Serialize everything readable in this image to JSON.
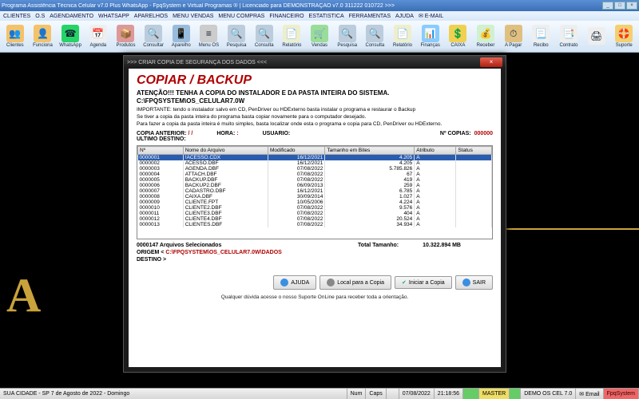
{
  "window": {
    "title": "Programa Assistência Técnica Celular v7.0 Plus WhatsApp - FpqSystem e Virtual Programas ® | Licenciado para  DEMONSTRAÇÃO v7.0 311222 010722 >>>"
  },
  "menu": [
    "CLIENTES",
    "O.S",
    "AGENDAMENTO",
    "WHATSAPP",
    "APARELHOS",
    "MENU VENDAS",
    "MENU COMPRAS",
    "FINANCEIRO",
    "ESTATISTICA",
    "FERRAMENTAS",
    "AJUDA",
    "✉ E-MAIL"
  ],
  "toolbar": [
    {
      "label": "Clientes",
      "ic": "👥",
      "bg": "#f3c26b"
    },
    {
      "label": "Funciona",
      "ic": "👤",
      "bg": "#f3c26b"
    },
    {
      "label": "WhatsApp",
      "ic": "☎",
      "bg": "#25d366"
    },
    {
      "label": "Agenda",
      "ic": "📅",
      "bg": "#eee"
    },
    {
      "label": "Produtos",
      "ic": "📦",
      "bg": "#d99"
    },
    {
      "label": "Consultar",
      "ic": "🔍",
      "bg": "#bcd"
    },
    {
      "label": "Aparelho",
      "ic": "📱",
      "bg": "#9bd"
    },
    {
      "label": "Menu OS",
      "ic": "≡",
      "bg": "#ccc"
    },
    {
      "label": "Pesquisa",
      "ic": "🔍",
      "bg": "#bcd"
    },
    {
      "label": "Consulta",
      "ic": "🔍",
      "bg": "#bcd"
    },
    {
      "label": "Relatório",
      "ic": "📄",
      "bg": "#eec"
    },
    {
      "label": "Vendas",
      "ic": "🛒",
      "bg": "#9d9"
    },
    {
      "label": "Pesquisa",
      "ic": "🔍",
      "bg": "#bcd"
    },
    {
      "label": "Consulta",
      "ic": "🔍",
      "bg": "#bcd"
    },
    {
      "label": "Relatório",
      "ic": "📄",
      "bg": "#eec"
    },
    {
      "label": "Finanças",
      "ic": "📊",
      "bg": "#8cf"
    },
    {
      "label": "CAIXA",
      "ic": "💲",
      "bg": "#f0d050"
    },
    {
      "label": "Receber",
      "ic": "💰",
      "bg": "#d0f0d0"
    },
    {
      "label": "A Pagar",
      "ic": "⏱",
      "bg": "#e0c080"
    },
    {
      "label": "Recibo",
      "ic": "📃",
      "bg": "#eee"
    },
    {
      "label": "Contrato",
      "ic": "📑",
      "bg": "#eee"
    },
    {
      "label": "",
      "ic": "🖨",
      "bg": "#eee"
    },
    {
      "label": "Suporte",
      "ic": "🛟",
      "bg": "#f3d070"
    }
  ],
  "dialog": {
    "title": ">>> CRIAR COPIA DE SEGURANÇA DOS DADOS <<<",
    "heading": "COPIAR / BACKUP",
    "warn": "ATENÇÃO!!!  TENHA A COPIA DO  INSTALADOR  E  DA PASTA INTEIRA DO  SISTEMA.",
    "sys_path": "C:\\FPQSYSTEM\\OS_CELULAR7.0W",
    "notes": [
      "IMPORTANTE: tendo o instalador salvo em CD, PenDriver ou HDExterno basta instalar o programa e restaurar o Backup",
      "Se tiver a copia da pasta inteira do programa basta copiar novamente para o computador desejado.",
      "Para fazer a copia da pasta inteira é muito simples, basta localizar onde esta o programa e copia para CD, PenDriver ou HDExterno."
    ],
    "copia_anterior_lbl": "COPIA ANTERIOR:",
    "copia_anterior_val": "/  /",
    "hora_lbl": "HORA:",
    "hora_val": ":",
    "usuario_lbl": "USUARIO:",
    "ncopias_lbl": "Nº COPIAS:",
    "ncopias_val": "000000",
    "ultimo_lbl": "ULTIMO DESTINO:",
    "grid_headers": [
      "Nº",
      "Nome do Arquivo",
      "Modificado",
      "Tamanho em Bites",
      "Atributo",
      "Status"
    ],
    "grid_rows": [
      [
        "0000001",
        "!ACESSO.CDX",
        "16/12/2021",
        "4.205",
        "A",
        ""
      ],
      [
        "0000002",
        "ACESSO.DBF",
        "16/12/2021",
        "4.205",
        "A",
        ""
      ],
      [
        "0000003",
        "AGENDA.DBF",
        "07/08/2022",
        "5.785.826",
        "A",
        ""
      ],
      [
        "0000004",
        "ATTACH.DBF",
        "07/08/2022",
        "67",
        "A",
        ""
      ],
      [
        "0000005",
        "BACKUP.DBF",
        "07/08/2022",
        "419",
        "A",
        ""
      ],
      [
        "0000006",
        "BACKUP2.DBF",
        "06/09/2013",
        "259",
        "A",
        ""
      ],
      [
        "0000007",
        "CADASTRO.DBF",
        "16/12/2021",
        "6.785",
        "A",
        ""
      ],
      [
        "0000008",
        "CAIXA.DBF",
        "30/09/2014",
        "1.027",
        "A",
        ""
      ],
      [
        "0000009",
        "CLIENTE.FPT",
        "10/05/2006",
        "4.224",
        "A",
        ""
      ],
      [
        "0000010",
        "CLIENTE2.DBF",
        "07/08/2022",
        "9.576",
        "A",
        ""
      ],
      [
        "0000011",
        "CLIENTE3.DBF",
        "07/08/2022",
        "404",
        "A",
        ""
      ],
      [
        "0000012",
        "CLIENTE4.DBF",
        "07/08/2022",
        "20.524",
        "A",
        ""
      ],
      [
        "0000013",
        "CLIENTES.DBF",
        "07/08/2022",
        "34.934",
        "A",
        ""
      ]
    ],
    "count_lbl": "0000147 Arquivos Selecionados",
    "total_lbl": "Total Tamanho:",
    "total_val": "10.322.894 MB",
    "origem_lbl": "ORIGEM  <",
    "origem_path": "C:\\FPQSYSTEM\\OS_CELULAR7.0W\\DADOS",
    "destino_lbl": "DESTINO >",
    "buttons": {
      "ajuda": "AJUDA",
      "local": "Local para a Copia",
      "iniciar": "Iniciar a Copia",
      "sair": "SAIR"
    },
    "foot": "Qualquer dúvida acesse o nosso Suporte OnLine para receber toda a orientação."
  },
  "status": {
    "left": "SUA CIDADE - SP  7 de Agosto de 2022 - Domingo",
    "num": "Num",
    "caps": "Caps",
    "date": "07/08/2022",
    "time": "21:18:56",
    "master": "MASTER",
    "demo": "DEMO OS CEL 7.0",
    "email": "✉ Email",
    "brand": "FpqSystem"
  }
}
